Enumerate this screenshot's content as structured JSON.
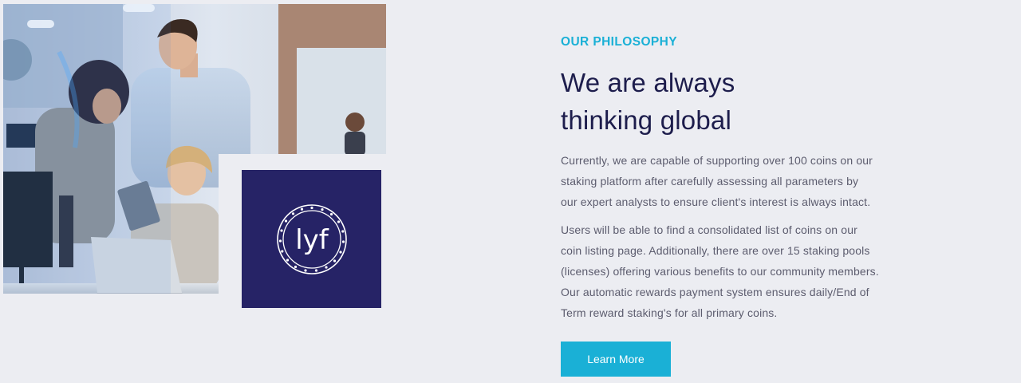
{
  "philosophy": {
    "eyebrow": "OUR PHILOSOPHY",
    "headline_line1": "We are always",
    "headline_line2": "thinking global",
    "paragraph1_lines": [
      "Currently, we are capable of supporting over 100 coins on our",
      "staking platform after carefully assessing all parameters by",
      "our expert analysts to ensure client's interest is always intact."
    ],
    "paragraph2_lines": [
      "Users will be able to find a consolidated list of coins on our",
      "coin listing page. Additionally, there are over 15 staking pools",
      "(licenses) offering various benefits to our community members.",
      "Our automatic rewards payment system ensures daily/End of",
      "Term reward staking's for all primary coins."
    ],
    "button_label": "Learn More"
  },
  "logo": {
    "text": "lyf",
    "background_color": "#262366"
  },
  "colors": {
    "accent": "#1ab0d6",
    "heading": "#1d1d4c",
    "body_text": "#5c5c6e",
    "page_background": "#ecedf2"
  }
}
